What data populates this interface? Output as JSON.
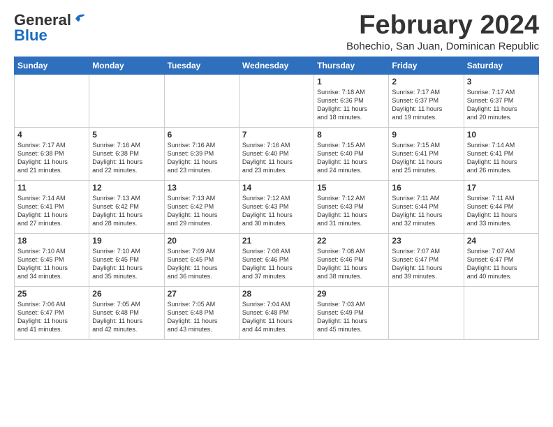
{
  "logo": {
    "general": "General",
    "blue": "Blue"
  },
  "header": {
    "month": "February 2024",
    "location": "Bohechio, San Juan, Dominican Republic"
  },
  "weekdays": [
    "Sunday",
    "Monday",
    "Tuesday",
    "Wednesday",
    "Thursday",
    "Friday",
    "Saturday"
  ],
  "weeks": [
    [
      {
        "day": "",
        "info": ""
      },
      {
        "day": "",
        "info": ""
      },
      {
        "day": "",
        "info": ""
      },
      {
        "day": "",
        "info": ""
      },
      {
        "day": "1",
        "info": "Sunrise: 7:18 AM\nSunset: 6:36 PM\nDaylight: 11 hours\nand 18 minutes."
      },
      {
        "day": "2",
        "info": "Sunrise: 7:17 AM\nSunset: 6:37 PM\nDaylight: 11 hours\nand 19 minutes."
      },
      {
        "day": "3",
        "info": "Sunrise: 7:17 AM\nSunset: 6:37 PM\nDaylight: 11 hours\nand 20 minutes."
      }
    ],
    [
      {
        "day": "4",
        "info": "Sunrise: 7:17 AM\nSunset: 6:38 PM\nDaylight: 11 hours\nand 21 minutes."
      },
      {
        "day": "5",
        "info": "Sunrise: 7:16 AM\nSunset: 6:38 PM\nDaylight: 11 hours\nand 22 minutes."
      },
      {
        "day": "6",
        "info": "Sunrise: 7:16 AM\nSunset: 6:39 PM\nDaylight: 11 hours\nand 23 minutes."
      },
      {
        "day": "7",
        "info": "Sunrise: 7:16 AM\nSunset: 6:40 PM\nDaylight: 11 hours\nand 23 minutes."
      },
      {
        "day": "8",
        "info": "Sunrise: 7:15 AM\nSunset: 6:40 PM\nDaylight: 11 hours\nand 24 minutes."
      },
      {
        "day": "9",
        "info": "Sunrise: 7:15 AM\nSunset: 6:41 PM\nDaylight: 11 hours\nand 25 minutes."
      },
      {
        "day": "10",
        "info": "Sunrise: 7:14 AM\nSunset: 6:41 PM\nDaylight: 11 hours\nand 26 minutes."
      }
    ],
    [
      {
        "day": "11",
        "info": "Sunrise: 7:14 AM\nSunset: 6:41 PM\nDaylight: 11 hours\nand 27 minutes."
      },
      {
        "day": "12",
        "info": "Sunrise: 7:13 AM\nSunset: 6:42 PM\nDaylight: 11 hours\nand 28 minutes."
      },
      {
        "day": "13",
        "info": "Sunrise: 7:13 AM\nSunset: 6:42 PM\nDaylight: 11 hours\nand 29 minutes."
      },
      {
        "day": "14",
        "info": "Sunrise: 7:12 AM\nSunset: 6:43 PM\nDaylight: 11 hours\nand 30 minutes."
      },
      {
        "day": "15",
        "info": "Sunrise: 7:12 AM\nSunset: 6:43 PM\nDaylight: 11 hours\nand 31 minutes."
      },
      {
        "day": "16",
        "info": "Sunrise: 7:11 AM\nSunset: 6:44 PM\nDaylight: 11 hours\nand 32 minutes."
      },
      {
        "day": "17",
        "info": "Sunrise: 7:11 AM\nSunset: 6:44 PM\nDaylight: 11 hours\nand 33 minutes."
      }
    ],
    [
      {
        "day": "18",
        "info": "Sunrise: 7:10 AM\nSunset: 6:45 PM\nDaylight: 11 hours\nand 34 minutes."
      },
      {
        "day": "19",
        "info": "Sunrise: 7:10 AM\nSunset: 6:45 PM\nDaylight: 11 hours\nand 35 minutes."
      },
      {
        "day": "20",
        "info": "Sunrise: 7:09 AM\nSunset: 6:45 PM\nDaylight: 11 hours\nand 36 minutes."
      },
      {
        "day": "21",
        "info": "Sunrise: 7:08 AM\nSunset: 6:46 PM\nDaylight: 11 hours\nand 37 minutes."
      },
      {
        "day": "22",
        "info": "Sunrise: 7:08 AM\nSunset: 6:46 PM\nDaylight: 11 hours\nand 38 minutes."
      },
      {
        "day": "23",
        "info": "Sunrise: 7:07 AM\nSunset: 6:47 PM\nDaylight: 11 hours\nand 39 minutes."
      },
      {
        "day": "24",
        "info": "Sunrise: 7:07 AM\nSunset: 6:47 PM\nDaylight: 11 hours\nand 40 minutes."
      }
    ],
    [
      {
        "day": "25",
        "info": "Sunrise: 7:06 AM\nSunset: 6:47 PM\nDaylight: 11 hours\nand 41 minutes."
      },
      {
        "day": "26",
        "info": "Sunrise: 7:05 AM\nSunset: 6:48 PM\nDaylight: 11 hours\nand 42 minutes."
      },
      {
        "day": "27",
        "info": "Sunrise: 7:05 AM\nSunset: 6:48 PM\nDaylight: 11 hours\nand 43 minutes."
      },
      {
        "day": "28",
        "info": "Sunrise: 7:04 AM\nSunset: 6:48 PM\nDaylight: 11 hours\nand 44 minutes."
      },
      {
        "day": "29",
        "info": "Sunrise: 7:03 AM\nSunset: 6:49 PM\nDaylight: 11 hours\nand 45 minutes."
      },
      {
        "day": "",
        "info": ""
      },
      {
        "day": "",
        "info": ""
      }
    ]
  ]
}
